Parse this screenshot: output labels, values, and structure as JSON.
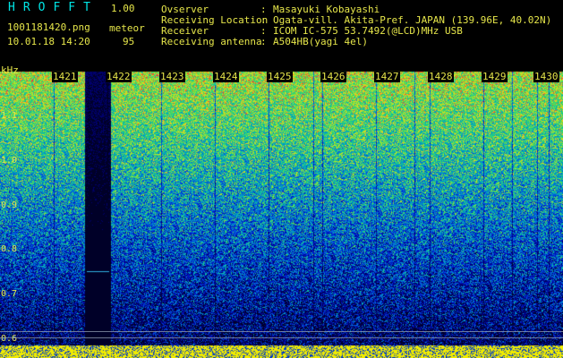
{
  "header": {
    "logo": "HROFFT",
    "version": "1.00",
    "filename": "1001181420.png",
    "datetime": "10.01.18 14:20",
    "mode": "meteor",
    "count": "95"
  },
  "station": [
    {
      "label": "Ovserver",
      "value": "Masayuki Kobayashi"
    },
    {
      "label": "Receiving Location",
      "value": "Ogata-vill. Akita-Pref. JAPAN (139.96E, 40.02N)"
    },
    {
      "label": "Receiver",
      "value": "ICOM IC-575 53.7492(@LCD)MHz USB"
    },
    {
      "label": "Receiving antenna",
      "value": "A504HB(yagi 4el)"
    }
  ],
  "axis": {
    "unit": "kHz",
    "y_ticks": [
      "1.1",
      "1.0",
      "0.9",
      "0.8",
      "0.7",
      "0.6"
    ],
    "minutes": [
      "1421",
      "1422",
      "1423",
      "1424",
      "1425",
      "1426",
      "1427",
      "1428",
      "1429",
      "1430"
    ]
  },
  "colors": {
    "text": "#e6e64a",
    "logo": "#00e5e5",
    "background": "#000000",
    "baseline_band": "#ffff00"
  }
}
